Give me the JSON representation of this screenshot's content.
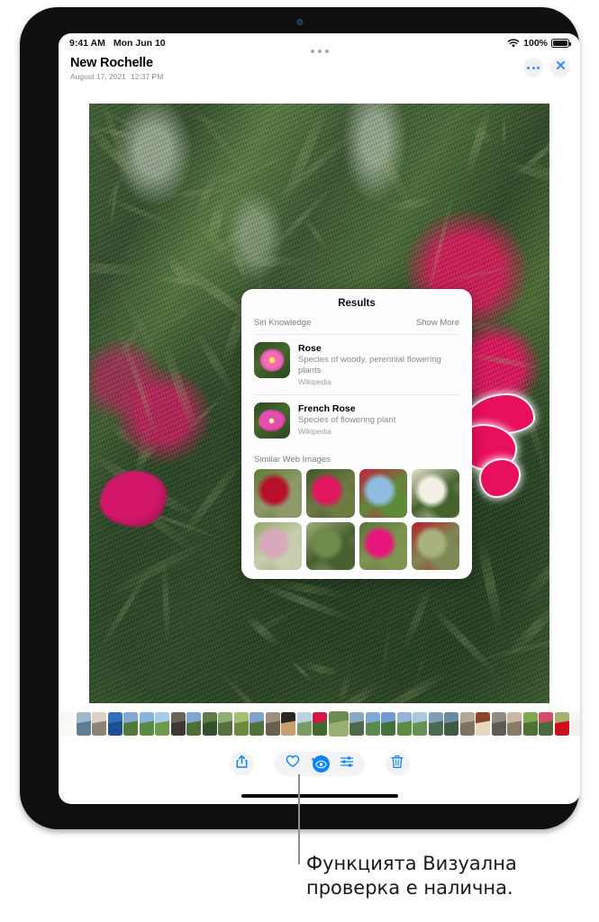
{
  "status_bar": {
    "time": "9:41 AM",
    "date": "Mon Jun 10",
    "battery_percent": "100%",
    "wifi_icon": "wifi-icon",
    "battery_icon": "battery-icon"
  },
  "header": {
    "title": "New Rochelle",
    "date": "August 17, 2021",
    "time": "12:37 PM",
    "more_icon": "more-dots-icon",
    "close_icon": "close-x-icon"
  },
  "results_panel": {
    "title": "Results",
    "section_label": "Siri Knowledge",
    "show_more_label": "Show More",
    "results": [
      {
        "name": "Rose",
        "description": "Species of woody, perennial flowering plants",
        "source": "Wikipedia",
        "thumb_icon": "rose-thumbnail"
      },
      {
        "name": " French Rose",
        "description": "Species of flowering plant",
        "source": "Wikipedia",
        "thumb_icon": "french-rose-thumbnail"
      }
    ],
    "similar_label": "Similar Web Images",
    "similar_images": [
      {
        "name": "red-rose-bush",
        "colors": [
          "#b8102b",
          "#5c7a34",
          "#8f9a6c"
        ]
      },
      {
        "name": "pink-rose-bush",
        "colors": [
          "#e0165f",
          "#3f5a28",
          "#6d7a42"
        ]
      },
      {
        "name": "rose-field-sky",
        "colors": [
          "#8fbce0",
          "#c8203f",
          "#5f8a3a"
        ]
      },
      {
        "name": "white-roses",
        "colors": [
          "#f2efe4",
          "#e8e2cf",
          "#46622c"
        ]
      },
      {
        "name": "pale-pink-roses",
        "colors": [
          "#d9a8bd",
          "#93a86e",
          "#c8cfae"
        ]
      },
      {
        "name": "rose-garden-rows",
        "colors": [
          "#6f8a4a",
          "#9fb07a",
          "#485f30"
        ]
      },
      {
        "name": "magenta-rose-buds",
        "colors": [
          "#e8157a",
          "#57753a",
          "#7f9450"
        ]
      },
      {
        "name": "red-rose-hedge",
        "colors": [
          "#a8b27e",
          "#b81f2b",
          "#7d8a55"
        ]
      }
    ]
  },
  "toolbar": {
    "share_icon": "share-icon",
    "favorite_icon": "heart-icon",
    "visual_lookup_icon": "visual-look-up-icon",
    "adjust_icon": "adjust-sliders-icon",
    "delete_icon": "trash-icon"
  },
  "photo": {
    "subject_name": "highlighted-rose",
    "accent_color": "#0a84ff",
    "highlight_color": "#ffffff"
  },
  "callout": {
    "caption": "Функцията Визуална проверка е налична."
  },
  "filmstrip": {
    "selected_index": 17,
    "thumbs": [
      {
        "colors": [
          "#e8e4dc",
          "#f0ece4"
        ],
        "faded": true
      },
      {
        "colors": [
          "#9fb8cc",
          "#5d7e96"
        ],
        "faded": false
      },
      {
        "colors": [
          "#d8d2c4",
          "#8e8376"
        ],
        "faded": false
      },
      {
        "colors": [
          "#2f6fbe",
          "#1d4f92"
        ],
        "faded": false
      },
      {
        "colors": [
          "#7fa8d4",
          "#4f7a3a"
        ],
        "faded": false
      },
      {
        "colors": [
          "#86b4de",
          "#5a8a42"
        ],
        "faded": false
      },
      {
        "colors": [
          "#a8cbe8",
          "#6f9a4e"
        ],
        "faded": false
      },
      {
        "colors": [
          "#6b6458",
          "#3e3a32"
        ],
        "faded": false
      },
      {
        "colors": [
          "#7ba8d2",
          "#4a7038"
        ],
        "faded": false
      },
      {
        "colors": [
          "#5f7a42",
          "#32502a"
        ],
        "faded": false
      },
      {
        "colors": [
          "#8fae72",
          "#566f3e"
        ],
        "faded": false
      },
      {
        "colors": [
          "#a4c070",
          "#6b8a3e"
        ],
        "faded": false
      },
      {
        "colors": [
          "#7fa2cc",
          "#4e7238"
        ],
        "faded": false
      },
      {
        "colors": [
          "#9a8f7c",
          "#6a5f4e"
        ],
        "faded": false
      },
      {
        "colors": [
          "#2a2622",
          "#c8a070"
        ],
        "faded": false
      },
      {
        "colors": [
          "#bcd2e4",
          "#7a9a68"
        ],
        "faded": false
      },
      {
        "colors": [
          "#d81646",
          "#3f6a2c"
        ],
        "faded": false
      },
      {
        "colors": [
          "#6f8a4e",
          "#9ab070"
        ],
        "faded": false
      },
      {
        "colors": [
          "#8aa8c4",
          "#4e6a48"
        ],
        "faded": false
      },
      {
        "colors": [
          "#7fa8d8",
          "#5c8a4a"
        ],
        "faded": false
      },
      {
        "colors": [
          "#6f9ad0",
          "#46703a"
        ],
        "faded": false
      },
      {
        "colors": [
          "#92b4d8",
          "#5f8a46"
        ],
        "faded": false
      },
      {
        "colors": [
          "#a8c8e0",
          "#6a9050"
        ],
        "faded": false
      },
      {
        "colors": [
          "#7f9eb8",
          "#4a6a52"
        ],
        "faded": false
      },
      {
        "colors": [
          "#6a8aa4",
          "#3e5a42"
        ],
        "faded": false
      },
      {
        "colors": [
          "#b4a894",
          "#7f7260"
        ],
        "faded": false
      },
      {
        "colors": [
          "#8a4428",
          "#e8d8c0"
        ],
        "faded": false
      },
      {
        "colors": [
          "#8f8a82",
          "#5f5a52"
        ],
        "faded": false
      },
      {
        "colors": [
          "#c8b8a4",
          "#8a7a68"
        ],
        "faded": false
      },
      {
        "colors": [
          "#7fa850",
          "#4e7232"
        ],
        "faded": false
      },
      {
        "colors": [
          "#d84a6a",
          "#4a6a3a"
        ],
        "faded": false
      },
      {
        "colors": [
          "#a8b070",
          "#d01020"
        ],
        "faded": false
      },
      {
        "colors": [
          "#e4e0d8",
          "#d8d0c4"
        ],
        "faded": true
      }
    ]
  }
}
